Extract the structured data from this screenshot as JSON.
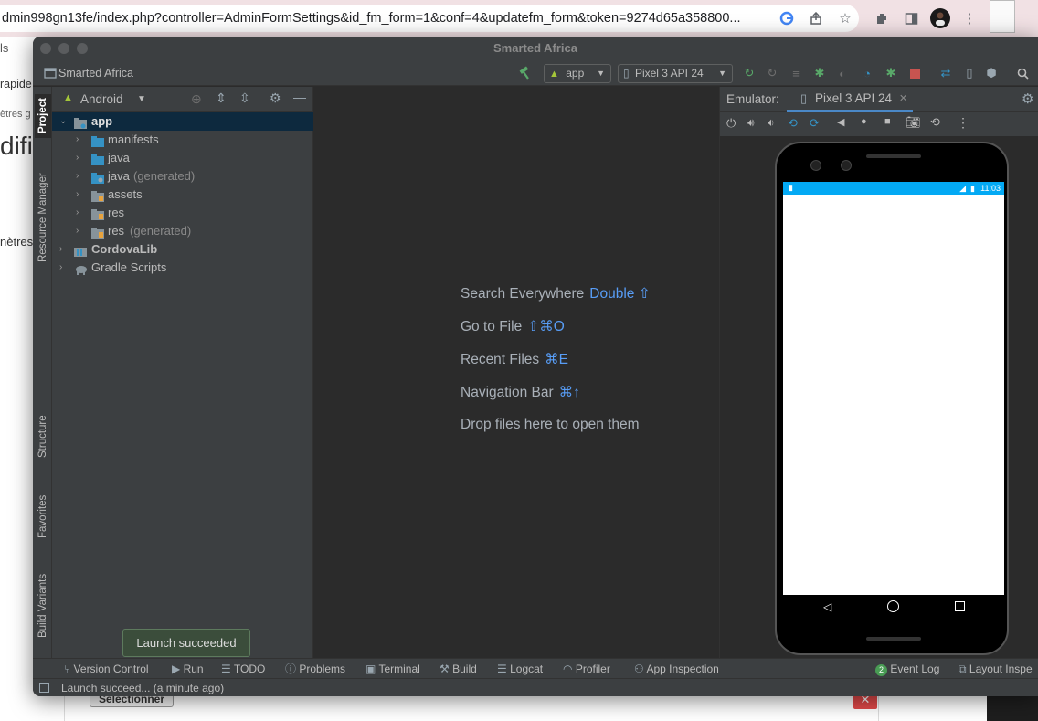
{
  "browser": {
    "url": "dmin998gn13fe/index.php?controller=AdminFormSettings&id_fm_form=1&conf=4&updatefm_form&token=9274d65a358800..."
  },
  "background_page": {
    "frag1": "ls",
    "frag2": "rapide",
    "frag3": "ètres g",
    "frag4": "difi",
    "frag5": "nètres",
    "select_button": "Sélectionner"
  },
  "window": {
    "title": "Smarted Africa"
  },
  "toolbar": {
    "project_name": "Smarted Africa",
    "run_config": "app",
    "device": "Pixel 3 API 24"
  },
  "left_strip": {
    "project": "Project",
    "resource_manager": "Resource Manager",
    "structure": "Structure",
    "favorites": "Favorites",
    "build_variants": "Build Variants"
  },
  "project_panel": {
    "view_mode": "Android",
    "tree": [
      {
        "label": "app",
        "suffix": ""
      },
      {
        "label": "manifests",
        "suffix": ""
      },
      {
        "label": "java",
        "suffix": ""
      },
      {
        "label": "java",
        "suffix": "(generated)"
      },
      {
        "label": "assets",
        "suffix": ""
      },
      {
        "label": "res",
        "suffix": ""
      },
      {
        "label": "res",
        "suffix": "(generated)"
      },
      {
        "label": "CordovaLib",
        "suffix": ""
      },
      {
        "label": "Gradle Scripts",
        "suffix": ""
      }
    ]
  },
  "editor": {
    "hints": [
      {
        "text": "Search Everywhere",
        "key": "Double ⇧"
      },
      {
        "text": "Go to File",
        "key": "⇧⌘O"
      },
      {
        "text": "Recent Files",
        "key": "⌘E"
      },
      {
        "text": "Navigation Bar",
        "key": "⌘↑"
      },
      {
        "text": "Drop files here to open them",
        "key": ""
      }
    ]
  },
  "emulator": {
    "label": "Emulator:",
    "tab": "Pixel 3 API 24",
    "clock": "11:03"
  },
  "bottom_bar": {
    "version_control": "Version Control",
    "run": "Run",
    "todo": "TODO",
    "problems": "Problems",
    "terminal": "Terminal",
    "build": "Build",
    "logcat": "Logcat",
    "profiler": "Profiler",
    "app_inspection": "App Inspection",
    "event_log_count": "2",
    "event_log": "Event Log",
    "layout_inspector": "Layout Inspe"
  },
  "status": {
    "text": "Launch succeed... (a minute ago)"
  },
  "tooltip": {
    "text": "Launch succeeded"
  },
  "colors": {
    "accent_blue": "#589df6",
    "android_green": "#a4c639",
    "selection": "#0d293e"
  }
}
